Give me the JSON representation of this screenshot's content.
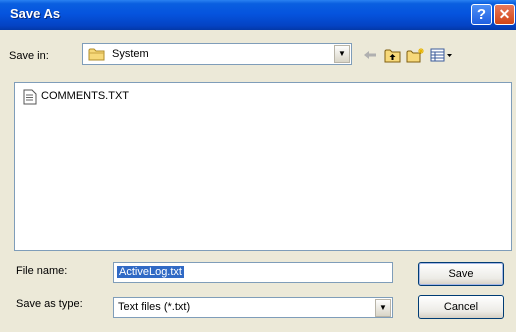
{
  "window": {
    "title": "Save As",
    "help_glyph": "?",
    "close_glyph": "✕"
  },
  "toolbar": {
    "save_in_label": "Save in:",
    "save_in_value": "System",
    "icons": [
      "back-arrow-icon",
      "up-folder-icon",
      "new-folder-icon",
      "view-menu-icon"
    ]
  },
  "files": [
    {
      "name": "COMMENTS.TXT",
      "icon": "text-file-icon"
    }
  ],
  "form": {
    "file_name_label": "File name:",
    "file_name_value": "ActiveLog.txt",
    "save_as_type_label": "Save as type:",
    "save_as_type_value": "Text files (*.txt)"
  },
  "buttons": {
    "save": "Save",
    "cancel": "Cancel"
  },
  "colors": {
    "titlebar": "#0554de",
    "dialog_bg": "#ECE9D8",
    "selection": "#316ac5"
  }
}
